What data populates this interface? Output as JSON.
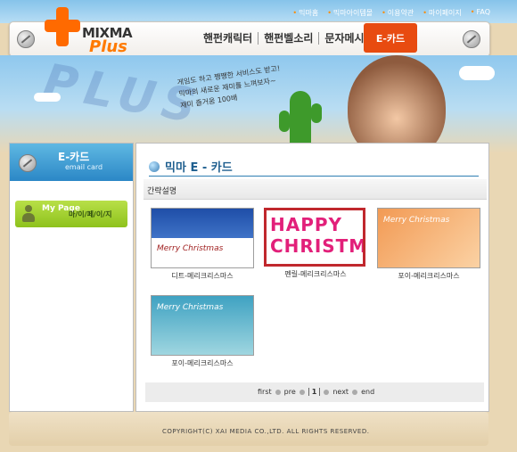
{
  "top_links": [
    "믹마홈",
    "믹마아이템몰",
    "이용약관",
    "마이페이지",
    "FAQ"
  ],
  "logo": {
    "line1": "MIXMA",
    "line2": "Plus"
  },
  "nav": {
    "items": [
      "핸펀캐릭터",
      "핸펀벨소리",
      "문자메시지"
    ],
    "active": "E-카드"
  },
  "hero": {
    "watermark": "PLUS",
    "slogan": [
      "게임도 하고 쨍쨍한 서비스도 받고!",
      "믹마의 새로운 재미를 느껴보자~",
      "재미 즐거움 100배"
    ]
  },
  "sidebar": {
    "ecard_title": "E-카드",
    "ecard_sub": "email card",
    "mypage_label": "My Page",
    "mypage_sub": "마/이/페/이/지"
  },
  "main": {
    "title": "믹마 E - 카드",
    "description_label": "간략설명",
    "cards": [
      {
        "caption": "디트-메리크리스마스",
        "thumb_text": "Merry Christmas"
      },
      {
        "caption": "펜릴-메리크리스마스",
        "thumb_text": "HAPPY CHRISTMAS"
      },
      {
        "caption": "포이-메리크리스마스",
        "thumb_text": "Merry Christmas"
      },
      {
        "caption": "포이-메리크리스마스",
        "thumb_text": "Merry Christmas"
      }
    ],
    "pagination": {
      "first": "first",
      "pre": "pre",
      "page": "1",
      "next": "next",
      "end": "end"
    }
  },
  "footer": {
    "copyright": "COPYRIGHT(C) XAI MEDIA CO.,LTD. ALL RIGHTS RESERVED."
  },
  "colors": {
    "accent_orange": "#ff6a00",
    "nav_active": "#e84b10",
    "ecard_blue": "#2b87c6",
    "mypage_green": "#8ec21c"
  }
}
